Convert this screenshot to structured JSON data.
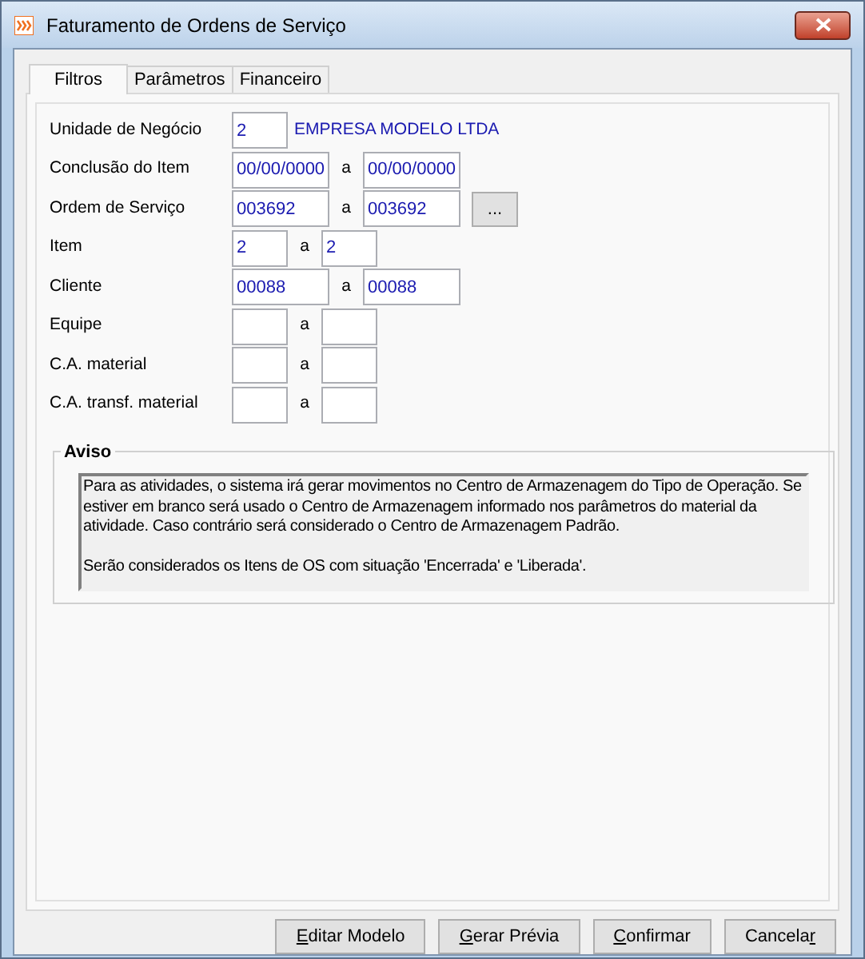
{
  "window": {
    "title": "Faturamento de Ordens de Serviço"
  },
  "tabs": [
    {
      "label": "Filtros",
      "selected": true
    },
    {
      "label": "Parâmetros",
      "selected": false
    },
    {
      "label": "Financeiro",
      "selected": false
    }
  ],
  "fields": [
    {
      "kind": "single",
      "label": "Unidade de Negócio",
      "value": "2",
      "description": "EMPRESA MODELO LTDA"
    },
    {
      "kind": "range",
      "label": "Conclusão do Item",
      "from": "00/00/0000",
      "separator": "a",
      "to": "00/00/0000"
    },
    {
      "kind": "range",
      "label": "Ordem de Serviço",
      "from": "003692",
      "separator": "a",
      "to": "003692",
      "lookup": "..."
    },
    {
      "kind": "short",
      "label": "Item",
      "from": "2",
      "separator": "a",
      "to": "2"
    },
    {
      "kind": "range",
      "label": "Cliente",
      "from": "00088",
      "separator": "a",
      "to": "00088"
    },
    {
      "kind": "short",
      "label": "Equipe",
      "separator": "a"
    },
    {
      "kind": "short",
      "label": "C.A. material",
      "separator": "a"
    },
    {
      "kind": "short",
      "label": "C.A. transf. material",
      "separator": "a"
    }
  ],
  "notice": {
    "title": "Aviso",
    "paragraphs": [
      "Para as atividades, o sistema irá gerar movimentos no Centro de Armazenagem do Tipo de Operação. Se estiver em branco será usado o Centro de Armazenagem informado nos parâmetros do material da atividade. Caso contrário será considerado o Centro de Armazenagem Padrão.",
      "Serão considerados os Itens de OS com situação 'Encerrada' e 'Liberada'."
    ]
  },
  "buttons": [
    {
      "access_key": "E",
      "label_end": "ditar Modelo"
    },
    {
      "access_key": "G",
      "label_end": "erar Prévia"
    },
    {
      "access_key": "C",
      "label_end": "onfirmar"
    },
    {
      "label_start": "Cancela",
      "access_key": "r"
    }
  ]
}
